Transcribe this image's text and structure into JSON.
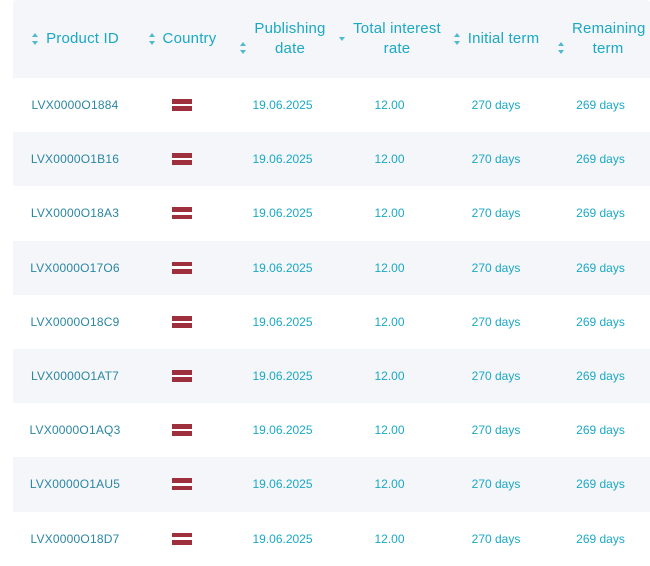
{
  "columns": [
    {
      "label": "Product ID",
      "sort": "both"
    },
    {
      "label": "Country",
      "sort": "both"
    },
    {
      "label": "Publishing date",
      "sort": "both"
    },
    {
      "label": "Total interest rate",
      "sort": "desc"
    },
    {
      "label": "Initial term",
      "sort": "both"
    },
    {
      "label": "Remaining term",
      "sort": "both"
    }
  ],
  "flag_colors": {
    "red": "#9e2f3d",
    "white": "#ffffff"
  },
  "rows": [
    {
      "product_id": "LVX0000O1884",
      "country_flag": "latvia-flag-icon",
      "publishing_date": "19.06.2025",
      "interest_rate": "12.00",
      "initial_term": "270 days",
      "remaining_term": "269 days"
    },
    {
      "product_id": "LVX0000O1B16",
      "country_flag": "latvia-flag-icon",
      "publishing_date": "19.06.2025",
      "interest_rate": "12.00",
      "initial_term": "270 days",
      "remaining_term": "269 days"
    },
    {
      "product_id": "LVX0000O18A3",
      "country_flag": "latvia-flag-icon",
      "publishing_date": "19.06.2025",
      "interest_rate": "12.00",
      "initial_term": "270 days",
      "remaining_term": "269 days"
    },
    {
      "product_id": "LVX0000O17O6",
      "country_flag": "latvia-flag-icon",
      "publishing_date": "19.06.2025",
      "interest_rate": "12.00",
      "initial_term": "270 days",
      "remaining_term": "269 days"
    },
    {
      "product_id": "LVX0000O18C9",
      "country_flag": "latvia-flag-icon",
      "publishing_date": "19.06.2025",
      "interest_rate": "12.00",
      "initial_term": "270 days",
      "remaining_term": "269 days"
    },
    {
      "product_id": "LVX0000O1AT7",
      "country_flag": "latvia-flag-icon",
      "publishing_date": "19.06.2025",
      "interest_rate": "12.00",
      "initial_term": "270 days",
      "remaining_term": "269 days"
    },
    {
      "product_id": "LVX0000O1AQ3",
      "country_flag": "latvia-flag-icon",
      "publishing_date": "19.06.2025",
      "interest_rate": "12.00",
      "initial_term": "270 days",
      "remaining_term": "269 days"
    },
    {
      "product_id": "LVX0000O1AU5",
      "country_flag": "latvia-flag-icon",
      "publishing_date": "19.06.2025",
      "interest_rate": "12.00",
      "initial_term": "270 days",
      "remaining_term": "269 days"
    },
    {
      "product_id": "LVX0000O18D7",
      "country_flag": "latvia-flag-icon",
      "publishing_date": "19.06.2025",
      "interest_rate": "12.00",
      "initial_term": "270 days",
      "remaining_term": "269 days"
    }
  ]
}
